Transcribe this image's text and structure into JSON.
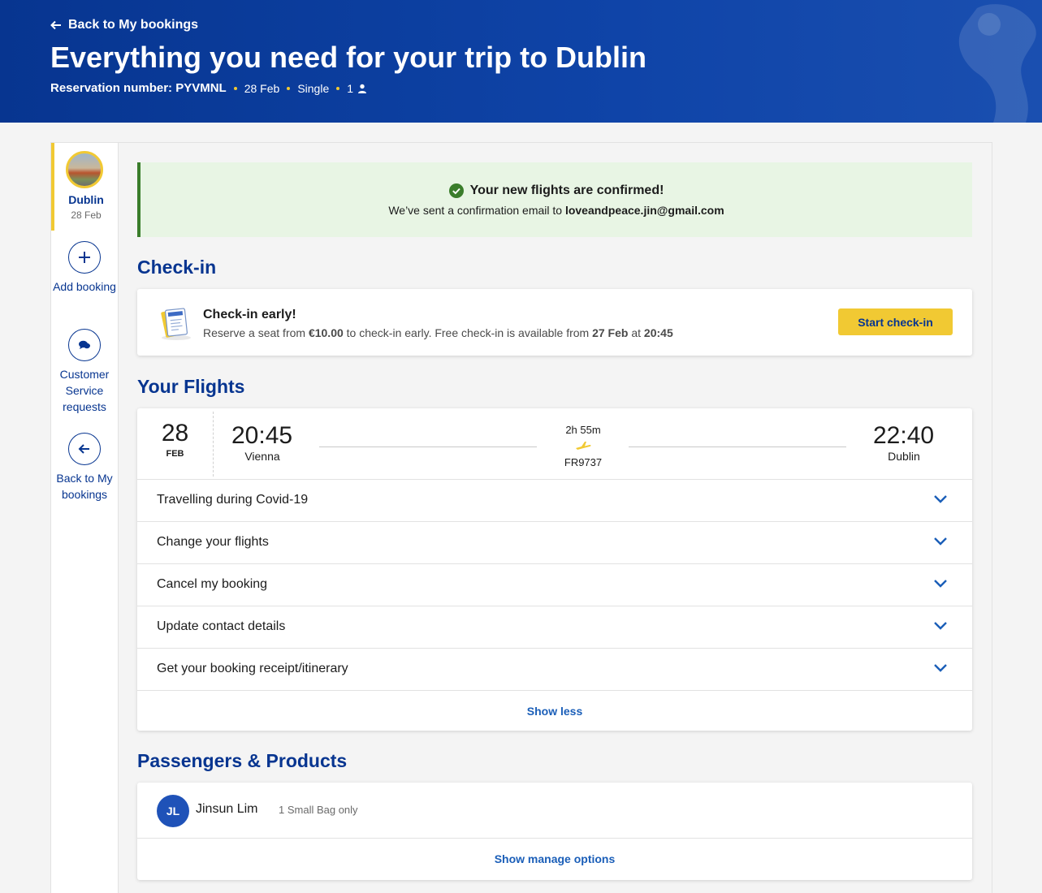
{
  "header": {
    "back_label": "Back to My bookings",
    "title": "Everything you need for your trip to Dublin",
    "reservation": "Reservation number: PYVMNL",
    "date": "28 Feb",
    "trip_type": "Single",
    "passengers": "1"
  },
  "sidebar": {
    "trip": {
      "name": "Dublin",
      "date": "28 Feb"
    },
    "items": [
      {
        "label": "Add booking",
        "icon": "plus-icon"
      },
      {
        "label": "Customer Service requests",
        "icon": "chat-icon"
      },
      {
        "label": "Back to My bookings",
        "icon": "arrow-left-icon"
      }
    ]
  },
  "confirmation": {
    "title": "Your new flights are confirmed!",
    "sub_prefix": "We’ve sent a confirmation email to",
    "email": "loveandpeace.jin@gmail.com"
  },
  "checkin": {
    "section_title": "Check-in",
    "title": "Check-in early!",
    "sub_1": "Reserve a seat from",
    "price": "€10.00",
    "sub_2": "to check-in early. Free check-in is available from",
    "free_date": "27 Feb",
    "sub_3": "at",
    "free_time": "20:45",
    "button": "Start check-in"
  },
  "flights": {
    "section_title": "Your Flights",
    "day": "28",
    "month": "FEB",
    "depart_time": "20:45",
    "depart_city": "Vienna",
    "duration": "2h 55m",
    "flight_number": "FR9737",
    "arrive_time": "22:40",
    "arrive_city": "Dublin",
    "options": [
      "Travelling during Covid-19",
      "Change your flights",
      "Cancel my booking",
      "Update contact details",
      "Get your booking receipt/itinerary"
    ],
    "show_less": "Show less"
  },
  "passengers": {
    "section_title": "Passengers & Products",
    "initials": "JL",
    "name": "Jinsun Lim",
    "product": "1 Small Bag only",
    "manage": "Show manage options"
  },
  "colors": {
    "brand_blue": "#073590",
    "accent_yellow": "#f1c933",
    "success_green": "#3a7d2b",
    "link_blue": "#1a5eb8"
  }
}
